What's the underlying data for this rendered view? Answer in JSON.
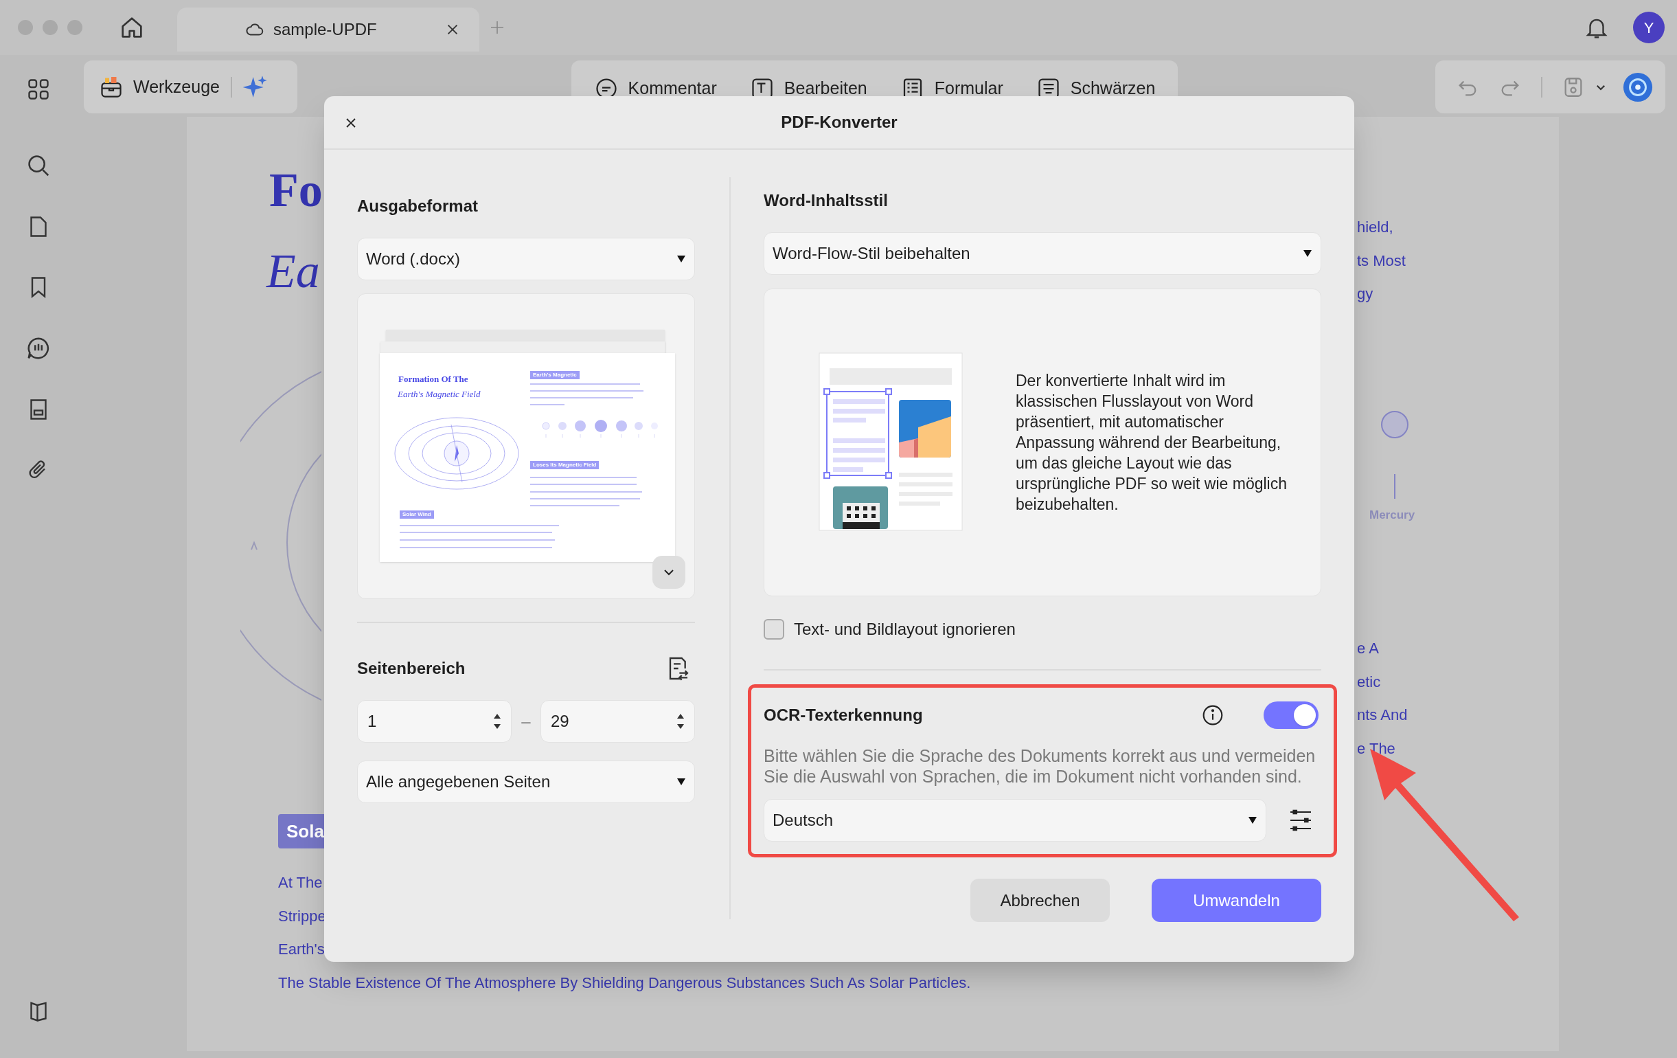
{
  "window": {
    "tab_title": "sample-UPDF",
    "avatar": "Y"
  },
  "toolbar": {
    "tools_button": "Werkzeuge",
    "items": [
      {
        "label": "Kommentar"
      },
      {
        "label": "Bearbeiten"
      },
      {
        "label": "Formular"
      },
      {
        "label": "Schwärzen"
      }
    ]
  },
  "document": {
    "title_fragment": "Fo",
    "subtitle_fragment": "Ea",
    "badge_fragment": "Sola",
    "lines": [
      "At The",
      "Strippe",
      "Earth's",
      "The Stable Existence Of The Atmosphere By Shielding Dangerous Substances Such As Solar Particles."
    ],
    "right_lines_top": [
      "hield,",
      "ts Most",
      "gy"
    ],
    "planet_label": "Mercury",
    "right_lines_bottom": [
      "e A",
      "etic",
      "nts And",
      "e The"
    ]
  },
  "dialog": {
    "title": "PDF-Konverter",
    "output_format": {
      "heading": "Ausgabeformat",
      "value": "Word (.docx)"
    },
    "preview": {
      "title": "Formation Of The",
      "subtitle": "Earth's Magnetic Field",
      "tags": [
        "Earth's Magnetic",
        "Loses Its Magnetic Field",
        "Solar Wind"
      ]
    },
    "page_range": {
      "heading": "Seitenbereich",
      "from": "1",
      "separator": "–",
      "to": "29",
      "pages": "Alle angegebenen Seiten"
    },
    "content_style": {
      "heading": "Word-Inhaltsstil",
      "value": "Word-Flow-Stil beibehalten",
      "description": "Der konvertierte Inhalt wird im klassischen Flusslayout von Word präsentiert, mit automatischer Anpassung während der Bearbeitung, um das gleiche Layout wie das ursprüngliche PDF so weit wie möglich beizubehalten."
    },
    "ignore_layout": {
      "label": "Text- und Bildlayout ignorieren",
      "checked": false
    },
    "ocr": {
      "heading": "OCR-Texterkennung",
      "on": true,
      "hint": "Bitte wählen Sie die Sprache des Dokuments korrekt aus und vermeiden Sie die Auswahl von Sprachen, die im Dokument nicht vorhanden sind.",
      "language": "Deutsch"
    },
    "buttons": [
      {
        "label": "Abbrechen",
        "kind": "secondary"
      },
      {
        "label": "Umwandeln",
        "kind": "primary"
      }
    ]
  }
}
